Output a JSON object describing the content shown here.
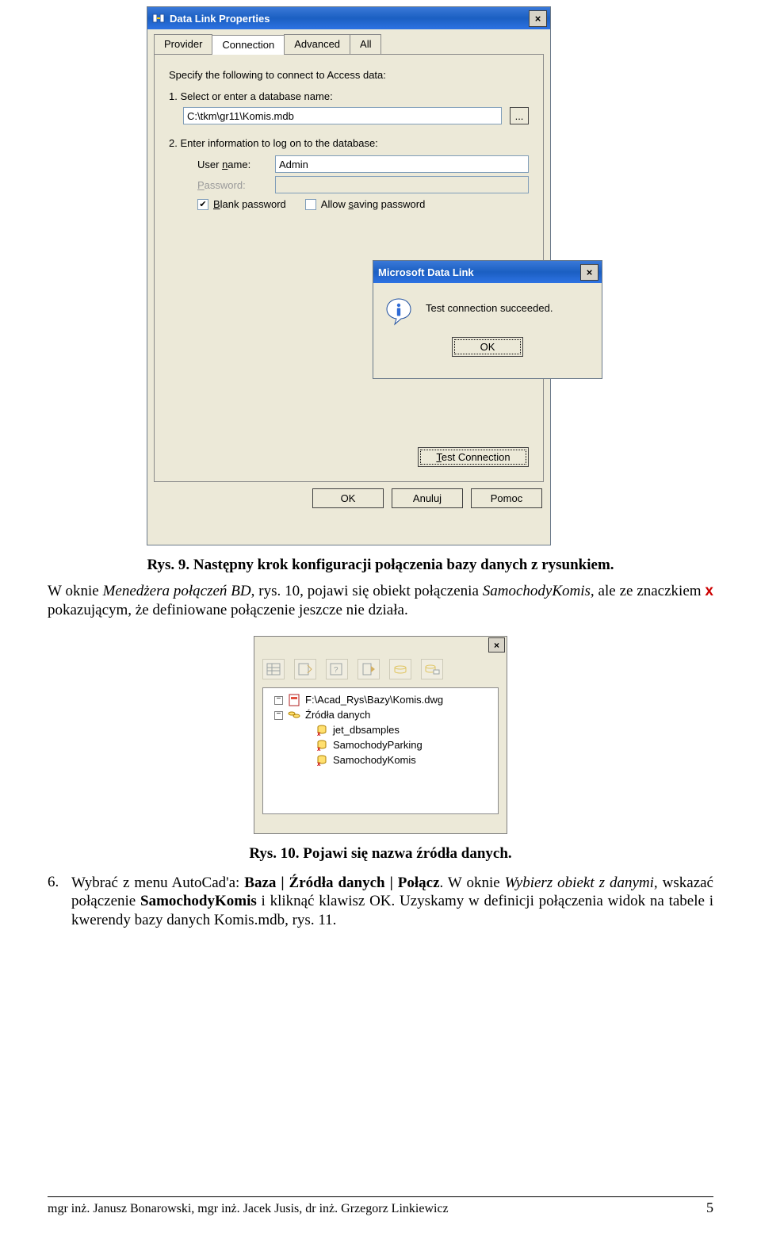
{
  "dialog1": {
    "title": "Data Link Properties",
    "tabs": [
      "Provider",
      "Connection",
      "Advanced",
      "All"
    ],
    "active_tab": 1,
    "instruction": "Specify the following to connect to Access data:",
    "step1": "1.  Select or enter a database name:",
    "db_path": "C:\\tkm\\gr11\\Komis.mdb",
    "dot_label": "...",
    "step2": "2.  Enter information to log on to the database:",
    "user_label_pre": "User ",
    "user_label_u": "n",
    "user_label_post": "ame:",
    "user_value": "Admin",
    "pwd_label_u": "P",
    "pwd_label_post": "assword:",
    "chk1_checked": true,
    "chk1_u": "B",
    "chk1_post": "lank password",
    "chk2_checked": false,
    "chk2_pre": "Allow ",
    "chk2_u": "s",
    "chk2_post": "aving password",
    "test_btn_u": "T",
    "test_btn_post": "est Connection",
    "ok": "OK",
    "cancel": "Anuluj",
    "help": "Pomoc"
  },
  "popup": {
    "title": "Microsoft Data Link",
    "message": "Test connection succeeded.",
    "ok": "OK"
  },
  "caption1": "Rys. 9. Następny krok konfiguracji połączenia bazy danych z rysunkiem.",
  "para1": {
    "pre_italic_lead": "W oknie ",
    "italic1": "Menedżera połączeń BD",
    "mid1": ", rys. 10, pojawi się obiekt połączenia ",
    "italic2": "SamochodyKomis",
    "mid2": ", ale ze znaczkiem ",
    "x": "x",
    "tail": " pokazującym, że definiowane połączenie jeszcze nie działa."
  },
  "panel": {
    "tree": {
      "root": "F:\\Acad_Rys\\Bazy\\Komis.dwg",
      "sources_label": "Źródła danych",
      "items": [
        "jet_dbsamples",
        "SamochodyParking",
        "SamochodyKomis"
      ]
    }
  },
  "caption2": "Rys. 10. Pojawi się nazwa źródła danych.",
  "item6": {
    "num": "6.",
    "lead": "Wybrać z menu AutoCad'a: ",
    "bold": "Baza | Źródła danych | Połącz",
    "mid1": ". W oknie ",
    "italic1": "Wybierz obiekt z danymi",
    "mid2": ", wskazać połączenie ",
    "bold2": "SamochodyKomis",
    "mid3": " i kliknąć klawisz OK. Uzyskamy w definicji połączenia widok na tabele i kwerendy bazy danych Komis.mdb, rys. 11."
  },
  "footer": "mgr inż. Janusz Bonarowski, mgr inż. Jacek Jusis, dr inż. Grzegorz Linkiewicz",
  "page": "5"
}
